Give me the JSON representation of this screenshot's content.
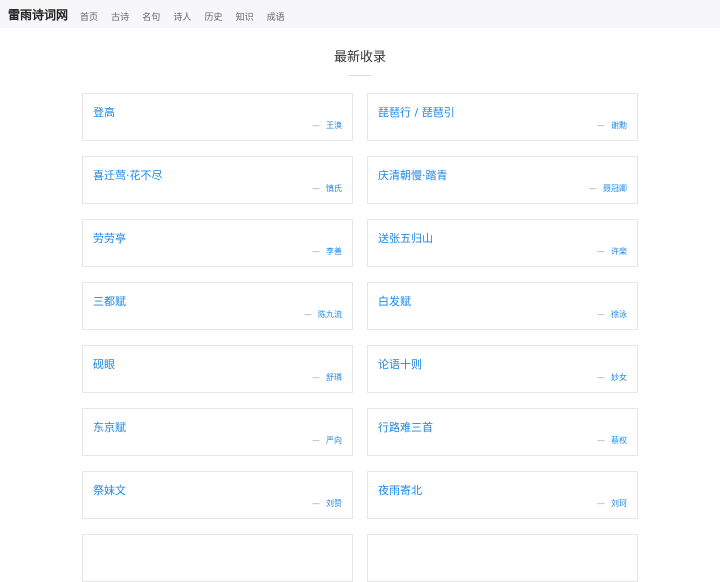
{
  "site": {
    "title": "雷雨诗词网"
  },
  "nav": {
    "items": [
      "首页",
      "古诗",
      "名句",
      "诗人",
      "历史",
      "知识",
      "成语"
    ]
  },
  "main": {
    "title": "最新收录"
  },
  "entries": [
    {
      "title": "登高",
      "author": "王涣"
    },
    {
      "title": "琵琶行 / 琵琶引",
      "author": "谢勳"
    },
    {
      "title": "喜迁莺·花不尽",
      "author": "慎氏"
    },
    {
      "title": "庆清朝慢·踏青",
      "author": "聂冠卿"
    },
    {
      "title": "劳劳亭",
      "author": "李善"
    },
    {
      "title": "送张五归山",
      "author": "许棐"
    },
    {
      "title": "三都赋",
      "author": "陈九流"
    },
    {
      "title": "白发赋",
      "author": "徐泳"
    },
    {
      "title": "砚眼",
      "author": "舒璘"
    },
    {
      "title": "论语十则",
      "author": "妙女"
    },
    {
      "title": "东京赋",
      "author": "严向"
    },
    {
      "title": "行路难三首",
      "author": "蔡权"
    },
    {
      "title": "祭妹文",
      "author": "刘赞"
    },
    {
      "title": "夜雨寄北",
      "author": "刘珂"
    }
  ],
  "colors": {
    "link": "#1e88e5",
    "topbar_bg": "#f7f7f9",
    "border": "#e6e6e6"
  }
}
